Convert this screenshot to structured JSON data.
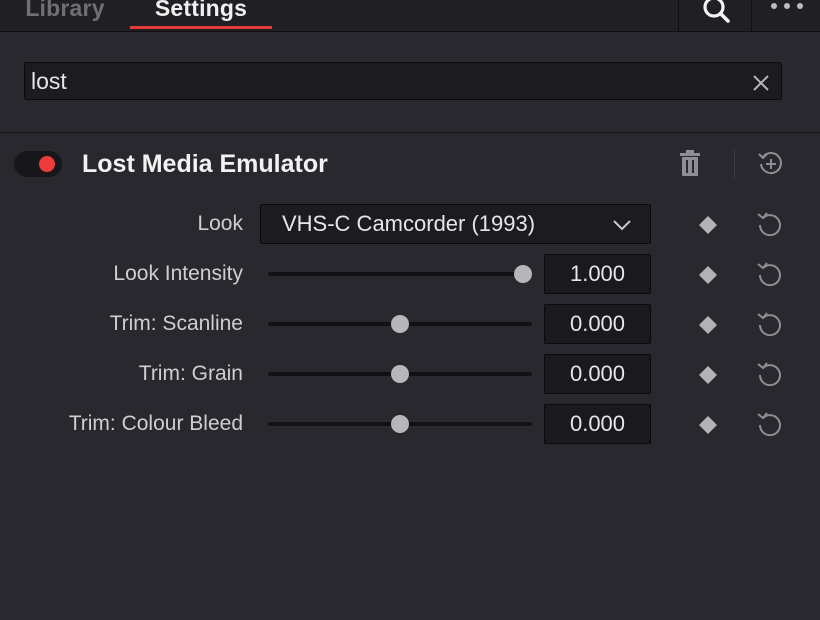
{
  "tabs": {
    "library": "Library",
    "settings": "Settings"
  },
  "search": {
    "value": "lost",
    "placeholder": ""
  },
  "effect": {
    "title": "Lost Media Emulator",
    "enabled": true,
    "toggle_color": "#ef3b3b"
  },
  "params": {
    "look": {
      "label": "Look",
      "value": "VHS-C Camcorder (1993)"
    },
    "look_intensity": {
      "label": "Look Intensity",
      "value": "1.000",
      "slider_fraction": 1.0
    },
    "trim_scanline": {
      "label": "Trim: Scanline",
      "value": "0.000",
      "slider_fraction": 0.5
    },
    "trim_grain": {
      "label": "Trim: Grain",
      "value": "0.000",
      "slider_fraction": 0.5
    },
    "trim_colour_bleed": {
      "label": "Trim: Colour Bleed",
      "value": "0.000",
      "slider_fraction": 0.5
    }
  },
  "colors": {
    "accent": "#e23b3b",
    "background": "#28282e",
    "field": "#1c1c20"
  },
  "icons": {
    "search": "search-icon",
    "more": "more-icon",
    "clear": "close-icon",
    "trash": "trash-icon",
    "add_preset": "add-preset-icon",
    "keyframe": "keyframe-diamond-icon",
    "reset": "reset-icon",
    "dropdown": "chevron-down-icon"
  }
}
